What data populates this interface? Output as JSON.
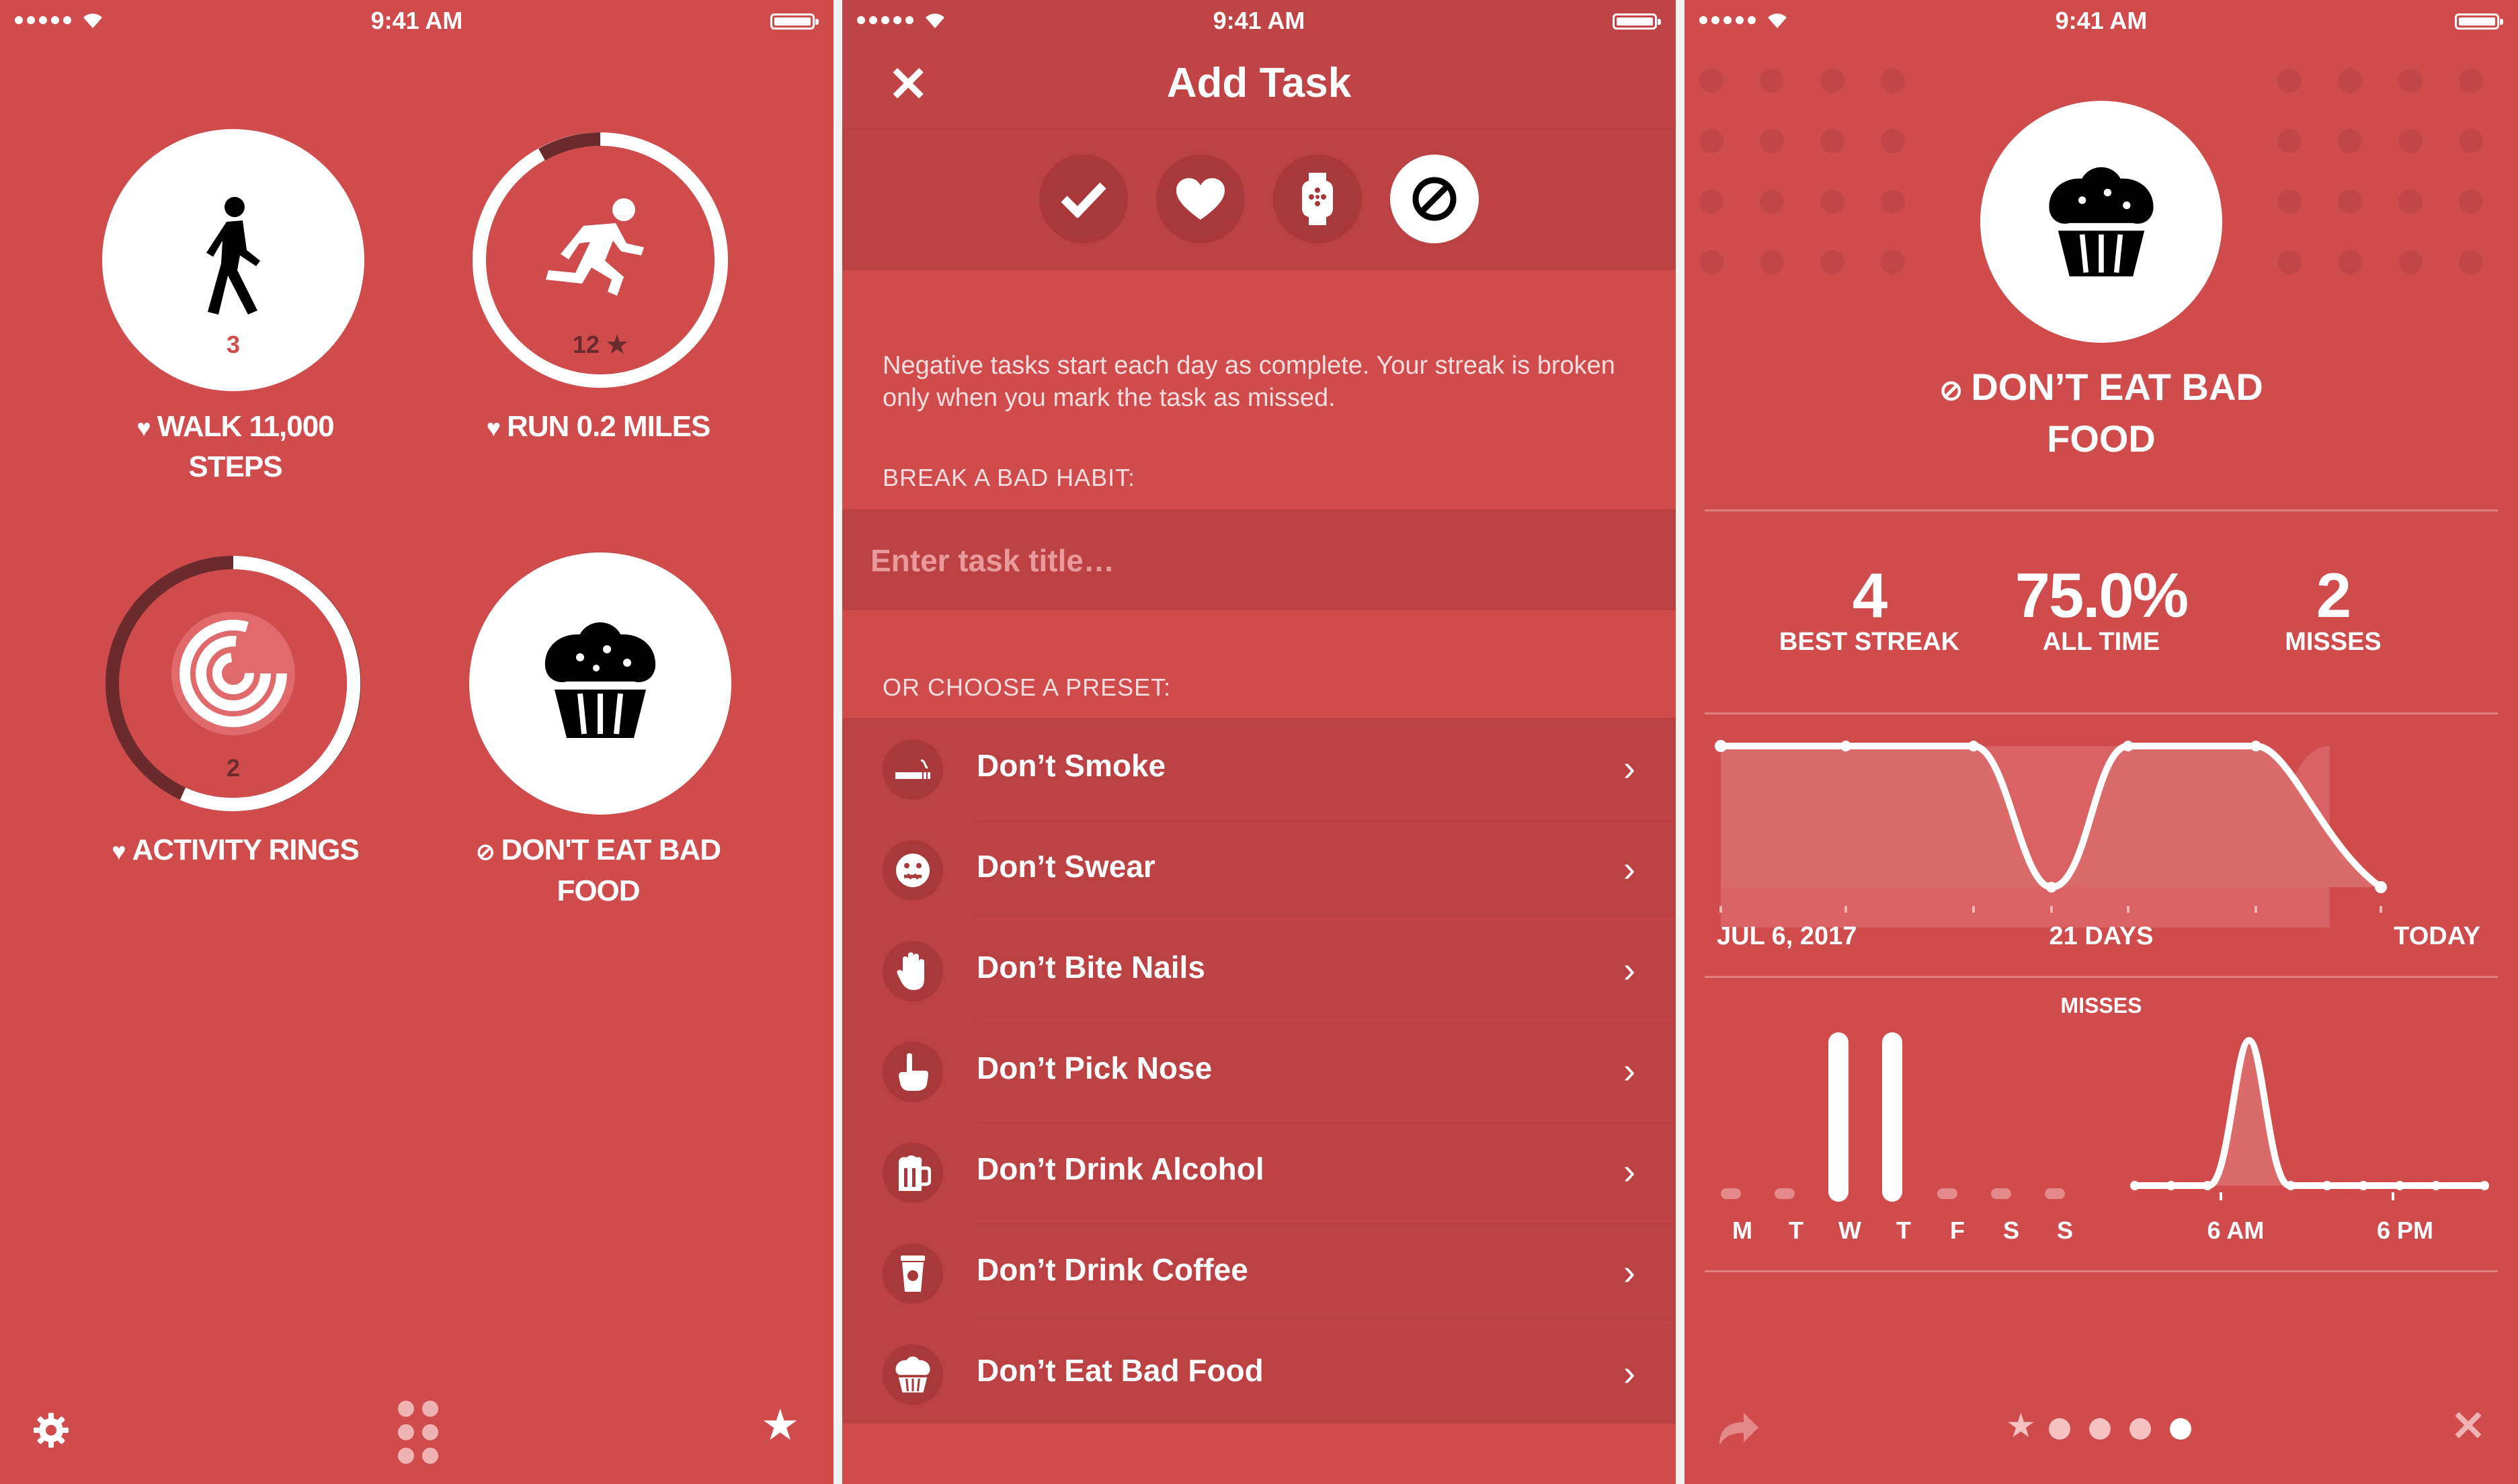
{
  "status": {
    "time": "9:41 AM"
  },
  "home": {
    "tasks": [
      {
        "label_line1": "WALK 11,000",
        "label_line2": "STEPS",
        "count": "3",
        "type_icon": "heart-icon",
        "task_icon": "walking-person-icon"
      },
      {
        "label_line1": "RUN 0.2 MILES",
        "count": "12",
        "type_icon": "heart-icon",
        "task_icon": "running-person-icon",
        "progress": 0.06
      },
      {
        "label_line1": "ACTIVITY RINGS",
        "count": "2",
        "type_icon": "heart-icon",
        "task_icon": "activity-rings-icon",
        "progress": 0.74
      },
      {
        "label_line1": "DON'T EAT BAD",
        "label_line2": "FOOD",
        "type_icon": "prohibited-icon",
        "task_icon": "muffin-icon"
      }
    ],
    "toolbar": [
      "gear-icon",
      "grid-icon",
      "star-icon"
    ]
  },
  "add_task": {
    "title": "Add Task",
    "close_icon": "close-icon",
    "types": [
      "check-icon",
      "heart-icon",
      "watch-icon",
      "prohibited-icon"
    ],
    "selected_type": "prohibited-icon",
    "explanation": "Negative tasks start each day as complete. Your streak is broken only when you mark the task as missed.",
    "section_habit": "BREAK A BAD HABIT:",
    "input_placeholder": "Enter task title…",
    "section_preset": "OR CHOOSE A PRESET:",
    "presets": [
      {
        "label": "Don’t Smoke",
        "icon": "cigarette-icon"
      },
      {
        "label": "Don’t Swear",
        "icon": "swear-face-icon"
      },
      {
        "label": "Don’t Bite Nails",
        "icon": "hand-icon"
      },
      {
        "label": "Don’t Pick Nose",
        "icon": "pointing-hand-icon"
      },
      {
        "label": "Don’t Drink Alcohol",
        "icon": "beer-mug-icon"
      },
      {
        "label": "Don’t Drink Coffee",
        "icon": "coffee-cup-icon"
      },
      {
        "label": "Don’t Eat Bad Food",
        "icon": "muffin-icon"
      }
    ]
  },
  "detail": {
    "title_line1": "DON’T EAT BAD",
    "title_line2": "FOOD",
    "stats": [
      {
        "value": "4",
        "label": "BEST STREAK"
      },
      {
        "value": "75.0%",
        "label": "ALL TIME"
      },
      {
        "value": "2",
        "label": "MISSES"
      }
    ],
    "timeline_labels": {
      "start": "JUL 6, 2017",
      "middle": "21 DAYS",
      "end": "TODAY"
    },
    "misses_title": "MISSES",
    "weekdays": [
      "M",
      "T",
      "W",
      "T",
      "F",
      "S",
      "S"
    ],
    "weekday_misses": [
      0,
      0,
      1,
      1,
      0,
      0,
      0
    ],
    "time_labels": [
      "6 AM",
      "6 PM"
    ],
    "bottom": {
      "left": "share-icon",
      "right": "close-icon"
    }
  },
  "colors": {
    "background": "#cf4b4c",
    "dark": "#bb4142",
    "darker": "#a83839",
    "ring_dark": "#6b2b2c"
  }
}
